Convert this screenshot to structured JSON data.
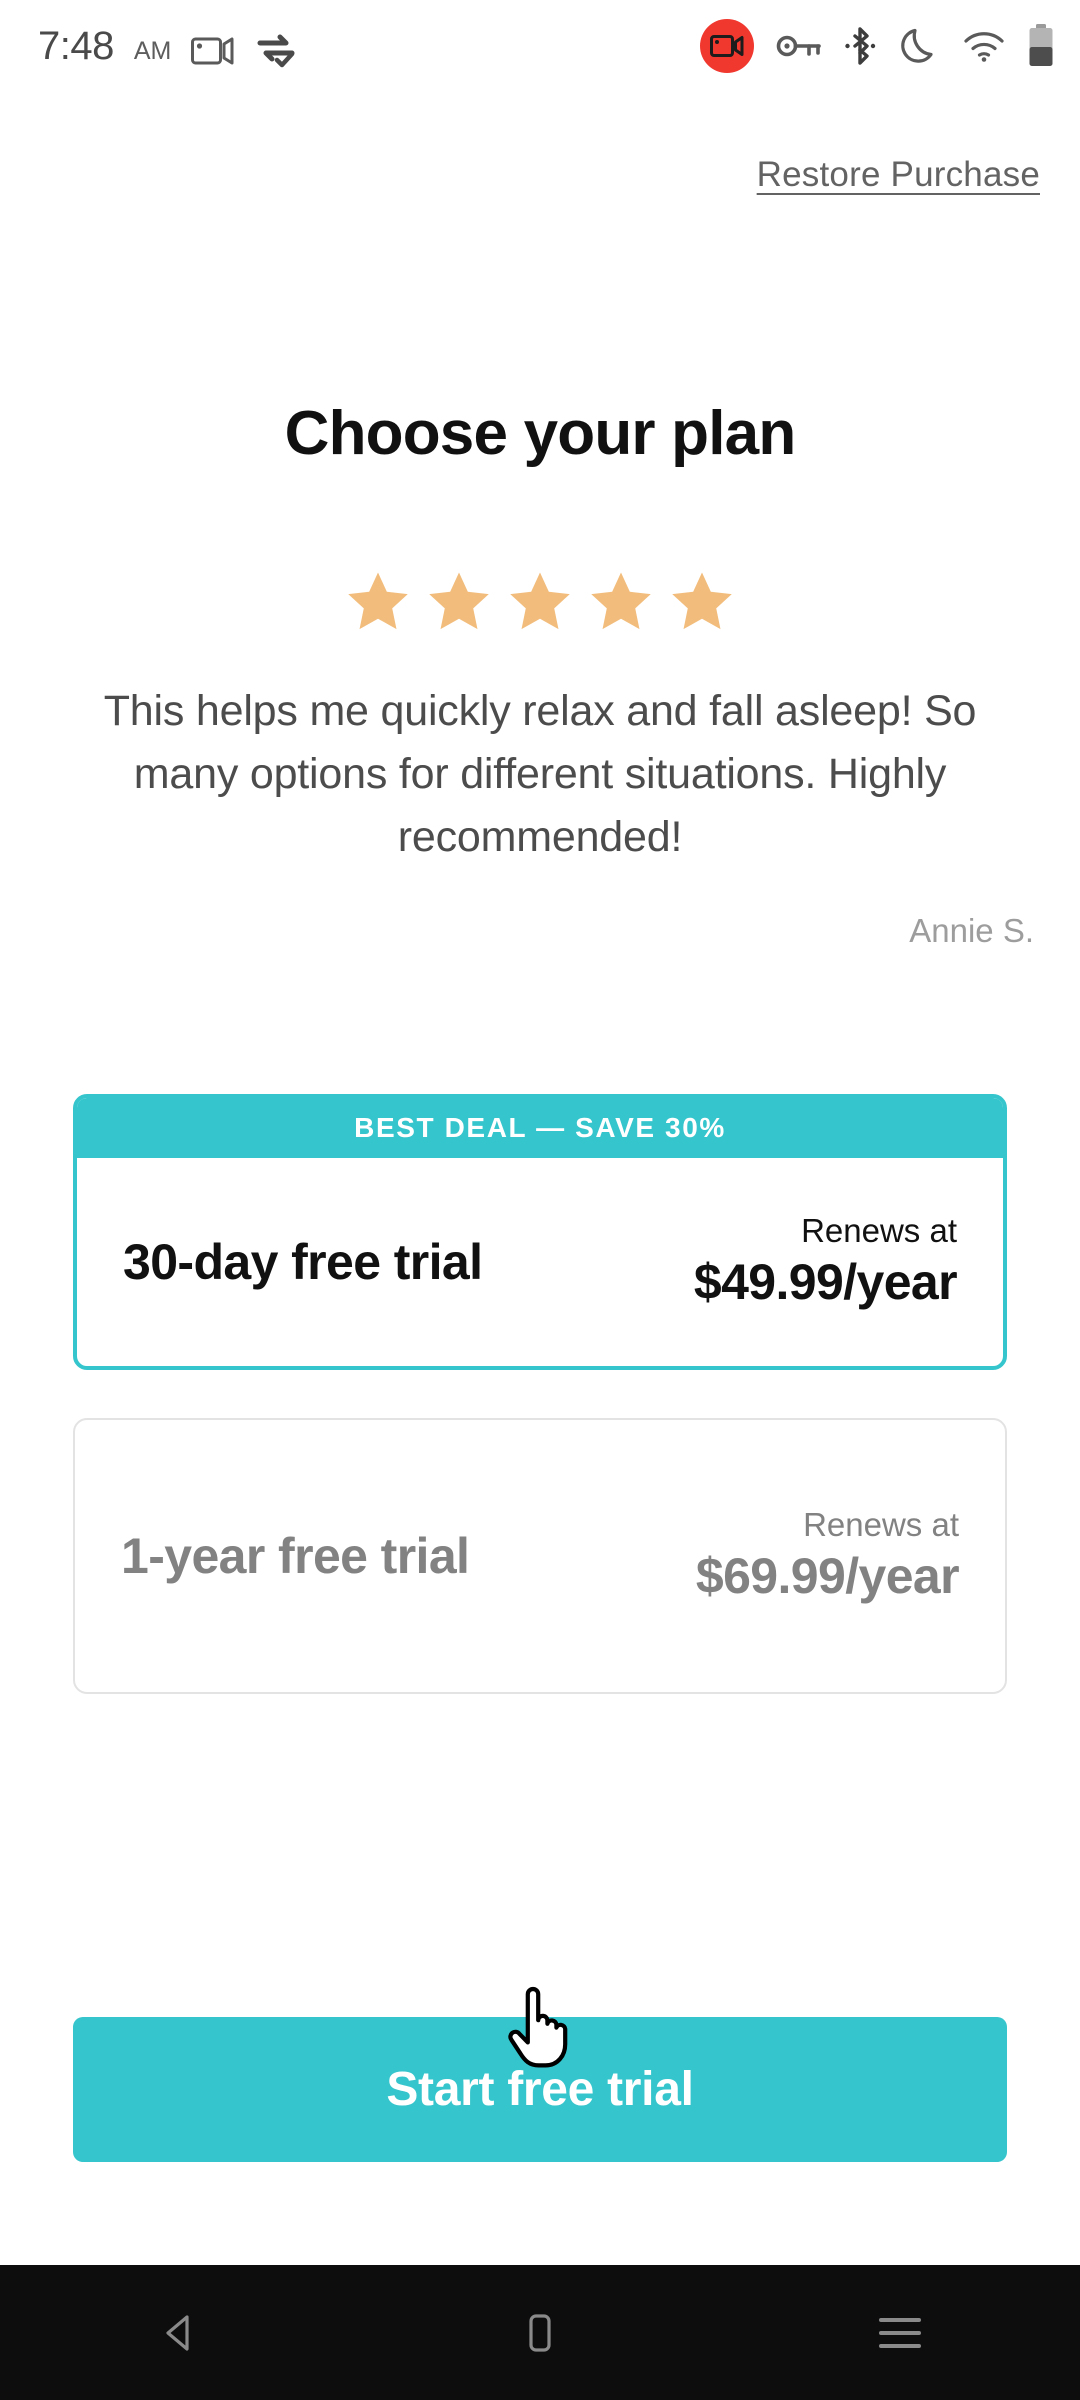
{
  "status_bar": {
    "time": "7:48",
    "ampm": "AM",
    "left_icons": [
      "screen-record-icon",
      "vpn-sync-icon"
    ],
    "right_icons": [
      "recording-badge-icon",
      "vpn-key-icon",
      "bluetooth-icon",
      "do-not-disturb-moon-icon",
      "wifi-icon",
      "battery-icon"
    ],
    "recording_badge_color": "#F0382F"
  },
  "header": {
    "restore_label": "Restore Purchase"
  },
  "main": {
    "title": "Choose your plan",
    "rating": {
      "stars_filled": 5,
      "star_color": "#F2BD7C"
    },
    "review": {
      "text": "This helps me quickly relax and fall asleep! So many options for different situations. Highly recommended!",
      "author": "Annie S."
    },
    "plans": [
      {
        "ribbon": "BEST DEAL — SAVE 30%",
        "name": "30-day free trial",
        "renews_label": "Renews at",
        "price": "$49.99/year",
        "selected": true
      },
      {
        "ribbon": null,
        "name": "1-year free trial",
        "renews_label": "Renews at",
        "price": "$69.99/year",
        "selected": false
      }
    ],
    "cta_label": "Start free trial"
  },
  "theme": {
    "accent": "#35C5CC",
    "text_dark": "#111111",
    "text_muted": "#828282",
    "border_light": "#E3E3E3"
  },
  "nav_bar": {
    "back_label": "Back",
    "home_label": "Home",
    "recents_label": "Recent apps"
  }
}
